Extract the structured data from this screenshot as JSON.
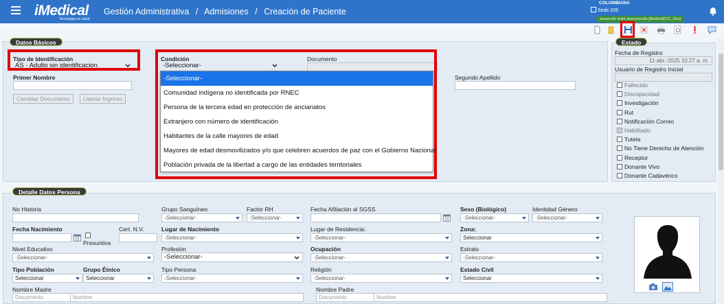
{
  "header": {
    "logo": "iMedical",
    "logo_sub": "Tecnología en salud",
    "breadcrumb": [
      "Gestión Administrativa",
      "/",
      "Admisiones",
      "/",
      "Creación de Paciente"
    ],
    "company": "COLOMBIANA",
    "site": "Sede 209",
    "env_badge": "desarrollo build desconocido [MedicalDCC_Dev]",
    "icons": [
      "hamburger-icon",
      "building-icon",
      "bell-icon"
    ]
  },
  "toolbar": {
    "icons": [
      "new-document-icon",
      "open-folder-icon",
      "save-icon",
      "cancel-icon",
      "print-icon",
      "preview-icon",
      "alert-icon",
      "chat-icon"
    ]
  },
  "datos_basicos": {
    "title": "Datos Básicos",
    "tipo_id_label": "Tipo de Identificación",
    "tipo_id_value": "AS - Adulto sin identificacion",
    "condicion_label": "Condición",
    "condicion_value": "-Seleccionar-",
    "documento_label": "Documento",
    "primer_nombre_label": "Primer Nombre",
    "segundo_apellido_label": "Segundo Apellido",
    "cambiar_documento": "Cambiar Documento",
    "llamar_ingreso": "Llamar Ingreso"
  },
  "condicion_dropdown": {
    "options": [
      "-Seleccionar-",
      "Comunidad indígena no identificada por RNEC",
      "Persona de la tercera edad en protección de ancianatos",
      "Extranjero con número de identificación",
      "Habitantes de la calle mayores de edad",
      "Mayores de edad desmovilizados y/o que celebren acuerdos de paz con el Gobierno Nacional",
      "Población privada de la libertad a cargo de las entidades territoriales"
    ],
    "selected_index": 0
  },
  "estado": {
    "title": "Estado",
    "fecha_registro_label": "Fecha de Registro",
    "fecha_registro_value": "11-abr.-2025 10:27 a. m.",
    "usuario_label": "Usuario de Registro Inicial",
    "checkboxes": [
      {
        "label": "Fallecido",
        "checked": false,
        "disabled": true
      },
      {
        "label": "Discapacidad",
        "checked": false,
        "disabled": true
      },
      {
        "label": "Investigación",
        "checked": false,
        "disabled": false
      },
      {
        "label": "Rut",
        "checked": false,
        "disabled": false
      },
      {
        "label": "Notificación Correo",
        "checked": false,
        "disabled": false
      },
      {
        "label": "Habilitado",
        "checked": true,
        "disabled": true
      },
      {
        "label": "Tutela",
        "checked": false,
        "disabled": false
      },
      {
        "label": "No Tiene Derecho de Atención",
        "checked": false,
        "disabled": false
      },
      {
        "label": "Receptor",
        "checked": false,
        "disabled": false
      },
      {
        "label": "Donante Vivo",
        "checked": false,
        "disabled": false
      },
      {
        "label": "Donante Cadavérico",
        "checked": false,
        "disabled": false
      }
    ]
  },
  "detalle": {
    "title": "Detalle Datos Persona",
    "no_historia": "No Historia",
    "grupo_sanguineo": "Grupo Sanguíneo",
    "factor_rh": "Factor RH",
    "fecha_afiliacion": "Fecha Afiliación al SGSS",
    "sexo": "Sexo (Biológico)",
    "identidad_genero": "Identidad Género",
    "fecha_nacimiento": "Fecha Nacimiento",
    "presuntiva": "Presuntiva",
    "cert_nv": "Cert. N.V.",
    "lugar_nacimiento": "Lugar de Nacimiento",
    "lugar_residencia": "Lugar de Residencia:",
    "zona": "Zona:",
    "nivel_educativo": "Nivel Educativo",
    "profesion": "Profesión",
    "ocupacion": "Ocupación",
    "estrato": "Estrato",
    "tipo_poblacion": "Tipo Población",
    "grupo_etnico": "Grupo Étnico",
    "tipo_persona": "Tipo Persona",
    "religion": "Religión",
    "estado_civil": "Estado Civil",
    "nombre_madre": "Nombre Madre",
    "nombre_padre": "Nombre Padre",
    "documento_ph": "Documento",
    "nombre_ph": "Nombre",
    "seleccionar_italic": "-Seleccionar-",
    "seleccionar_dash": "-Seleccionar-",
    "seleccionar_plain": "Seleccionar"
  }
}
